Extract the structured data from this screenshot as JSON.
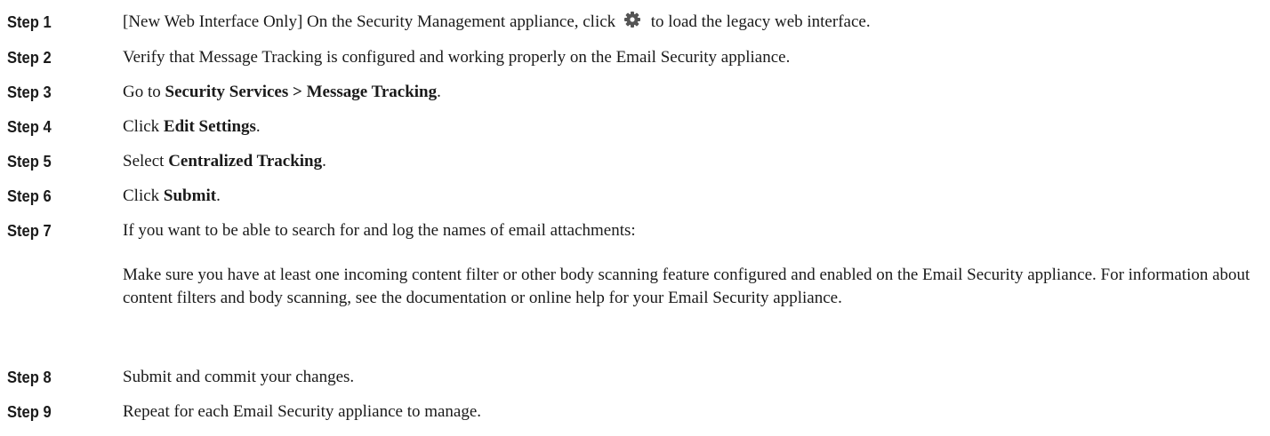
{
  "steps": [
    {
      "label": "Step 1",
      "parts": [
        {
          "t": "[New Web Interface Only] On the Security Management appliance, click "
        },
        {
          "icon": "gear-icon"
        },
        {
          "t": " to load the legacy web interface."
        }
      ]
    },
    {
      "label": "Step 2",
      "parts": [
        {
          "t": "Verify that Message Tracking is configured and working properly on the Email Security appliance."
        }
      ]
    },
    {
      "label": "Step 3",
      "parts": [
        {
          "t": "Go to "
        },
        {
          "b": "Security Services > Message Tracking"
        },
        {
          "t": "."
        }
      ]
    },
    {
      "label": "Step 4",
      "parts": [
        {
          "t": "Click "
        },
        {
          "b": "Edit Settings"
        },
        {
          "t": "."
        }
      ]
    },
    {
      "label": "Step 5",
      "parts": [
        {
          "t": "Select "
        },
        {
          "b": "Centralized Tracking"
        },
        {
          "t": "."
        }
      ]
    },
    {
      "label": "Step 6",
      "parts": [
        {
          "t": "Click "
        },
        {
          "b": "Submit"
        },
        {
          "t": "."
        }
      ]
    },
    {
      "label": "Step 7",
      "parts": [
        {
          "t": "If you want to be able to search for and log the names of email attachments:"
        }
      ]
    },
    {
      "label": "Step 8",
      "parts": [
        {
          "t": "Submit and commit your changes."
        }
      ]
    },
    {
      "label": "Step 9",
      "parts": [
        {
          "t": "Repeat for each Email Security appliance to manage."
        }
      ]
    }
  ],
  "step7_note": "Make sure you have at least one incoming content filter or other body scanning feature configured and enabled on the Email Security appliance. For information about content filters and body scanning, see the documentation or online help for your Email Security appliance."
}
